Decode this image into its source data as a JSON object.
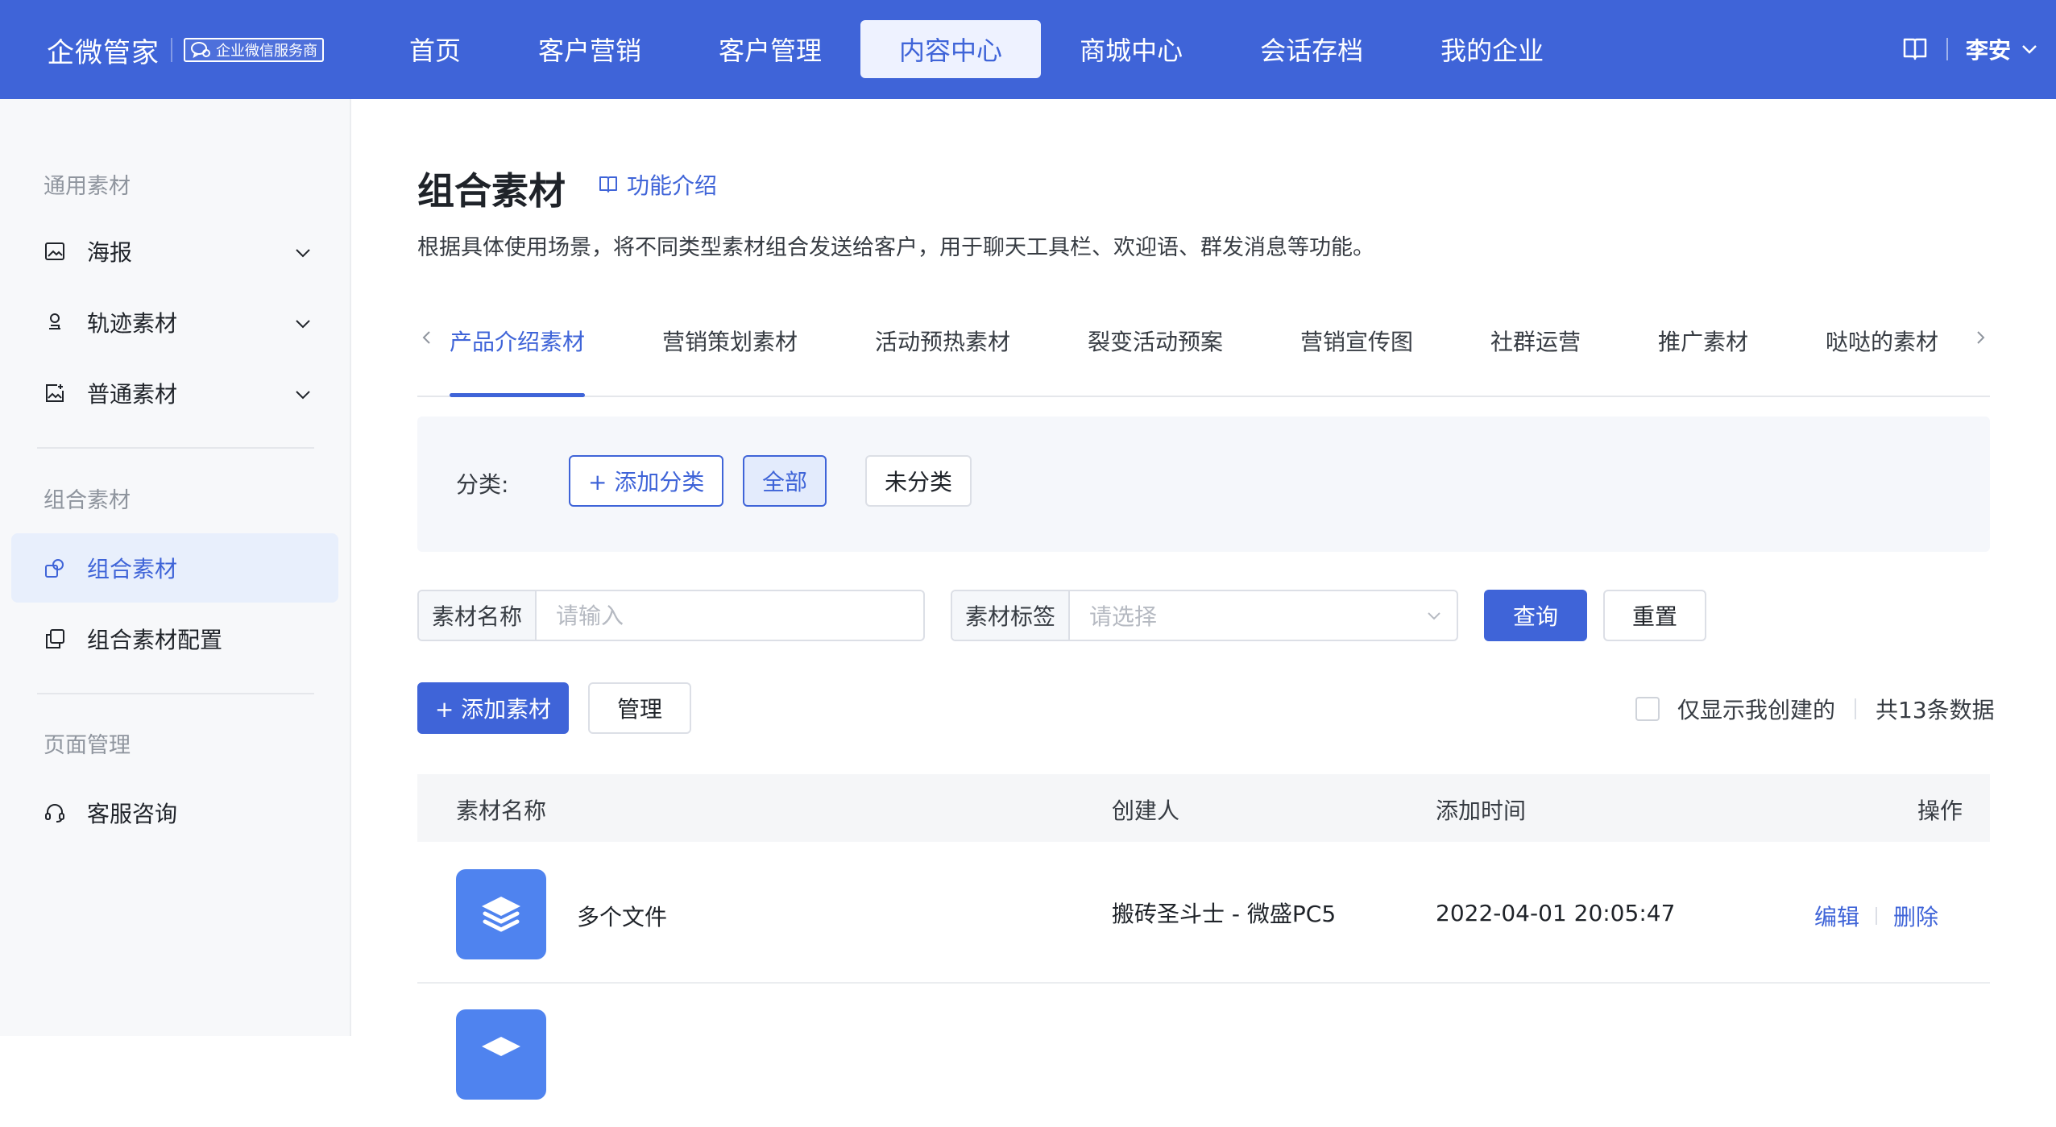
{
  "header": {
    "brand": "企微管家",
    "badge": "企业微信服务商",
    "nav": [
      {
        "label": "首页",
        "active": false
      },
      {
        "label": "客户营销",
        "active": false
      },
      {
        "label": "客户管理",
        "active": false
      },
      {
        "label": "内容中心",
        "active": true
      },
      {
        "label": "商城中心",
        "active": false
      },
      {
        "label": "会话存档",
        "active": false
      },
      {
        "label": "我的企业",
        "active": false
      }
    ],
    "user": "李安",
    "icons": {
      "help": "book-icon",
      "user_menu": "chevron-down-icon"
    }
  },
  "sidebar": {
    "groups": [
      {
        "title": "通用素材",
        "items": [
          {
            "label": "海报",
            "icon": "image-icon",
            "expandable": true
          },
          {
            "label": "轨迹素材",
            "icon": "stamp-icon",
            "expandable": true
          },
          {
            "label": "普通素材",
            "icon": "image-plus-icon",
            "expandable": true
          }
        ]
      },
      {
        "title": "组合素材",
        "items": [
          {
            "label": "组合素材",
            "icon": "combine-icon",
            "active": true
          },
          {
            "label": "组合素材配置",
            "icon": "copy-icon"
          }
        ]
      },
      {
        "title": "页面管理",
        "items": [
          {
            "label": "客服咨询",
            "icon": "headset-icon"
          }
        ]
      }
    ]
  },
  "main": {
    "title": "组合素材",
    "intro_link": "功能介绍",
    "description": "根据具体使用场景，将不同类型素材组合发送给客户，用于聊天工具栏、欢迎语、群发消息等功能。",
    "tabs": [
      "产品介绍素材",
      "营销策划素材",
      "活动预热素材",
      "裂变活动预案",
      "营销宣传图",
      "社群运营",
      "推广素材",
      "哒哒的素材"
    ],
    "active_tab": 0,
    "category": {
      "label": "分类:",
      "add": "+ 添加分类",
      "all": "全部",
      "uncategorized": "未分类"
    },
    "search": {
      "name_label": "素材名称",
      "name_placeholder": "请输入",
      "tag_label": "素材标签",
      "tag_placeholder": "请选择",
      "query": "查询",
      "reset": "重置"
    },
    "actions": {
      "add": "+ 添加素材",
      "manage": "管理",
      "only_mine": "仅显示我创建的",
      "total": "共13条数据"
    },
    "table": {
      "headers": [
        "素材名称",
        "创建人",
        "添加时间",
        "操作"
      ],
      "rows": [
        {
          "name": "多个文件",
          "creator": "搬砖圣斗士 - 微盛PC5",
          "time": "2022-04-01 20:05:47",
          "edit": "编辑",
          "delete": "删除"
        }
      ]
    }
  },
  "colors": {
    "primary": "#3f64d8",
    "nav_active_bg": "#eef2ff",
    "sidebar_bg": "#f7f8fa",
    "file_icon": "#4f83ef"
  }
}
